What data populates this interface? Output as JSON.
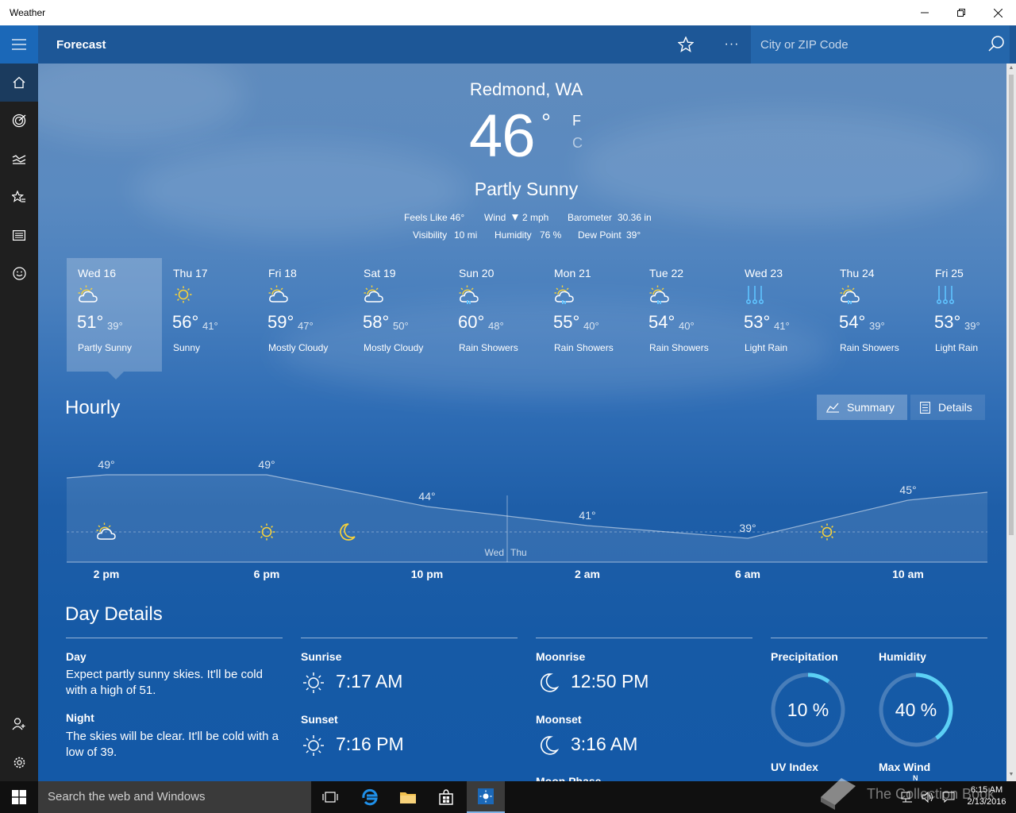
{
  "window": {
    "title": "Weather"
  },
  "header": {
    "page_title": "Forecast",
    "search_placeholder": "City or ZIP Code",
    "more_label": "···"
  },
  "nav": {
    "items": [
      "home-icon",
      "radar-icon",
      "chart-icon",
      "favorites-icon",
      "news-icon",
      "smiley-icon"
    ],
    "bottom": [
      "account-icon",
      "settings-icon"
    ]
  },
  "current": {
    "location": "Redmond, WA",
    "temp": "46",
    "deg": "°",
    "unit_f": "F",
    "unit_c": "C",
    "condition": "Partly Sunny",
    "feels_like_label": "Feels Like",
    "feels_like": "46°",
    "wind_label": "Wind",
    "wind": "2 mph",
    "barometer_label": "Barometer",
    "barometer": "30.36 in",
    "visibility_label": "Visibility",
    "visibility": "10 mi",
    "humidity_label": "Humidity",
    "humidity": "76 %",
    "dewpoint_label": "Dew Point",
    "dewpoint": "39°"
  },
  "daily": [
    {
      "day": "Wed 16",
      "hi": "51°",
      "lo": "39°",
      "cond": "Partly Sunny",
      "icon": "partly-sunny"
    },
    {
      "day": "Thu 17",
      "hi": "56°",
      "lo": "41°",
      "cond": "Sunny",
      "icon": "sunny"
    },
    {
      "day": "Fri 18",
      "hi": "59°",
      "lo": "47°",
      "cond": "Mostly Cloudy",
      "icon": "mostly-cloudy"
    },
    {
      "day": "Sat 19",
      "hi": "58°",
      "lo": "50°",
      "cond": "Mostly Cloudy",
      "icon": "mostly-cloudy"
    },
    {
      "day": "Sun 20",
      "hi": "60°",
      "lo": "48°",
      "cond": "Rain Showers",
      "icon": "rain-showers"
    },
    {
      "day": "Mon 21",
      "hi": "55°",
      "lo": "40°",
      "cond": "Rain Showers",
      "icon": "rain-showers"
    },
    {
      "day": "Tue 22",
      "hi": "54°",
      "lo": "40°",
      "cond": "Rain Showers",
      "icon": "rain-showers"
    },
    {
      "day": "Wed 23",
      "hi": "53°",
      "lo": "41°",
      "cond": "Light Rain",
      "icon": "light-rain"
    },
    {
      "day": "Thu 24",
      "hi": "54°",
      "lo": "39°",
      "cond": "Rain Showers",
      "icon": "rain-showers"
    },
    {
      "day": "Fri 25",
      "hi": "53°",
      "lo": "39°",
      "cond": "Light Rain",
      "icon": "light-rain"
    }
  ],
  "hourly": {
    "title": "Hourly",
    "summary_label": "Summary",
    "details_label": "Details",
    "time_labels": [
      "2 pm",
      "6 pm",
      "10 pm",
      "2 am",
      "6 am",
      "10 am"
    ],
    "temps": [
      49,
      49,
      44,
      41,
      39,
      45
    ],
    "temp_labels": [
      "49°",
      "49°",
      "44°",
      "41°",
      "39°",
      "45°"
    ],
    "day_boundary": [
      "Wed",
      "Thu"
    ],
    "icons": [
      "partly-sunny",
      "sunny",
      "moon",
      "sunny"
    ]
  },
  "details": {
    "title": "Day Details",
    "day_label": "Day",
    "day_text": "Expect partly sunny skies. It'll be cold with a high of 51.",
    "night_label": "Night",
    "night_text": "The skies will be clear. It'll be cold with a low of 39.",
    "sunrise_label": "Sunrise",
    "sunrise": "7:17 AM",
    "sunset_label": "Sunset",
    "sunset": "7:16 PM",
    "moonrise_label": "Moonrise",
    "moonrise": "12:50 PM",
    "moonset_label": "Moonset",
    "moonset": "3:16 AM",
    "moonphase_label": "Moon Phase",
    "precip_label": "Precipitation",
    "precip": "10 %",
    "precip_fraction": 0.1,
    "humidity_label": "Humidity",
    "humidity": "40 %",
    "humidity_fraction": 0.4,
    "uv_label": "UV Index",
    "maxwind_label": "Max Wind",
    "compass_n": "N"
  },
  "taskbar": {
    "search_placeholder": "Search the web and Windows",
    "time": "6:15 AM",
    "date": "2/13/2016"
  },
  "watermark": "The Collection Book",
  "colors": {
    "accent": "#1b68b8",
    "icon_yellow": "#f7d23a",
    "icon_blue": "#5fc3ff",
    "ring": "#5bd0f5"
  }
}
